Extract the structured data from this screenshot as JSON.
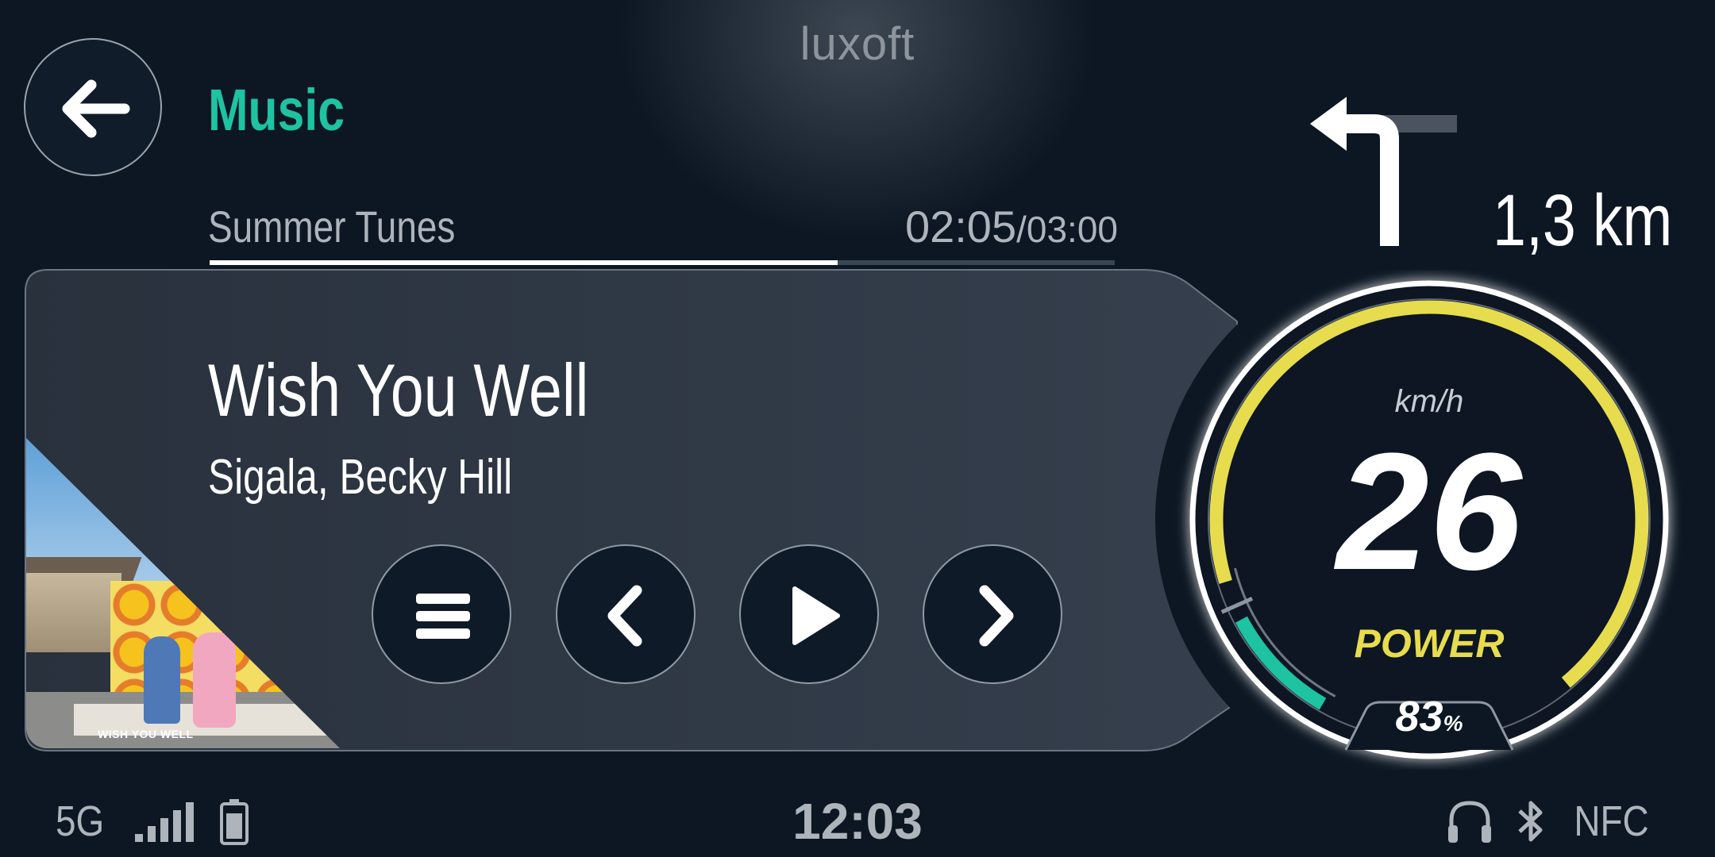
{
  "brand": "luxoft",
  "header": {
    "app_title": "Music",
    "playlist": "Summer Tunes",
    "elapsed": "02:05",
    "duration": "/03:00",
    "progress": 0.694
  },
  "track": {
    "title": "Wish You Well",
    "artist": "Sigala, Becky Hill",
    "album_caption": "WISH YOU WELL"
  },
  "controls": {
    "menu_icon": "menu-icon",
    "prev_icon": "chevron-left-icon",
    "play_icon": "play-icon",
    "next_icon": "chevron-right-icon"
  },
  "navigation": {
    "turn": "left",
    "distance": "1,3 km"
  },
  "gauge": {
    "unit": "km/h",
    "speed": "26",
    "mode": "POWER",
    "battery_value": "83",
    "battery_unit": "%",
    "colors": {
      "accent": "#1ec3a2",
      "power": "#e6dc4e",
      "ring": "#ffffff"
    }
  },
  "status_bar": {
    "network": "5G",
    "clock": "12:03",
    "nfc": "NFC"
  }
}
